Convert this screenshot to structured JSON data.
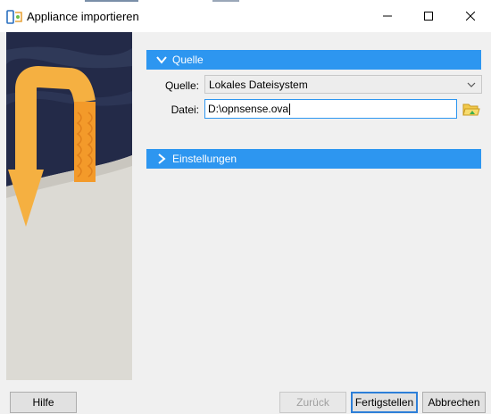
{
  "window": {
    "title": "Appliance importieren",
    "controls": {
      "minimize": "—",
      "maximize": "☐",
      "close": "✕"
    }
  },
  "sections": {
    "source": {
      "header": "Quelle",
      "source_label": "Quelle:",
      "source_value": "Lokales Dateisystem",
      "file_label": "Datei:",
      "file_value": "D:\\opnsense.ova"
    },
    "settings": {
      "header": "Einstellungen"
    }
  },
  "buttons": {
    "help": "Hilfe",
    "back": "Zurück",
    "finish": "Fertigstellen",
    "cancel": "Abbrechen"
  },
  "colors": {
    "accent": "#2d96f0",
    "arrow": "#f5b041",
    "sky": "#232a48"
  }
}
